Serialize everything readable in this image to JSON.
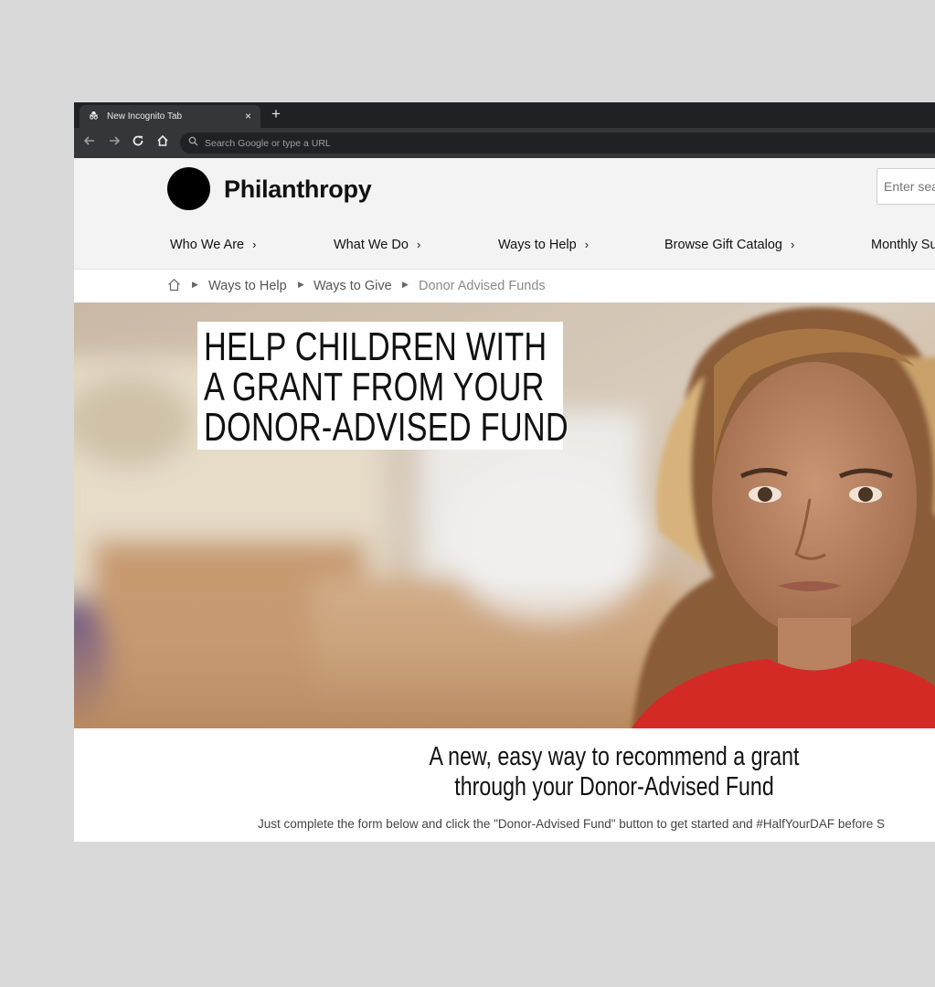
{
  "browser": {
    "tab_title": "New Incognito Tab",
    "tab_close": "×",
    "new_tab": "+",
    "omnibox_placeholder": "Search Google or type a URL",
    "icons": [
      "incognito-icon",
      "back-icon",
      "forward-icon",
      "reload-icon",
      "home-icon",
      "search-icon"
    ]
  },
  "site": {
    "logo_text": "Philanthropy",
    "search_placeholder": "Enter search",
    "nav": [
      {
        "label": "Who We Are"
      },
      {
        "label": "What We Do"
      },
      {
        "label": "Ways to Help"
      },
      {
        "label": "Browse Gift Catalog"
      },
      {
        "label": "Monthly Su"
      }
    ],
    "nav_chevron": "›"
  },
  "breadcrumb": {
    "items": [
      "Ways to Help",
      "Ways to Give",
      "Donor Advised Funds"
    ]
  },
  "hero": {
    "headline_lines": [
      "HELP CHILDREN WITH",
      "A GRANT FROM YOUR",
      "DONOR-ADVISED FUND"
    ]
  },
  "content": {
    "subhead_lines": [
      "A new, easy way to recommend a grant",
      "through your Donor-Advised Fund"
    ],
    "intro": "Just complete the form below and click the \"Donor-Advised Fund\" button to get started and #HalfYourDAF before S"
  },
  "colors": {
    "page_background": "#d9d9d9",
    "browser_chrome": "#202124",
    "site_header": "#f3f3f3",
    "shirt_red": "#d42a25"
  }
}
